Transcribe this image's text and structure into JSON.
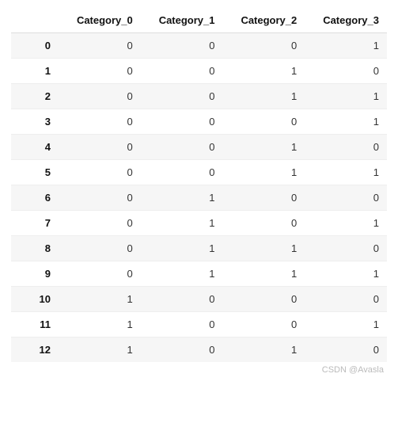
{
  "watermark": "CSDN @Avasla",
  "chart_data": {
    "type": "table",
    "title": "",
    "columns": [
      "Category_0",
      "Category_1",
      "Category_2",
      "Category_3"
    ],
    "index": [
      "0",
      "1",
      "2",
      "3",
      "4",
      "5",
      "6",
      "7",
      "8",
      "9",
      "10",
      "11",
      "12"
    ],
    "rows": [
      [
        0,
        0,
        0,
        1
      ],
      [
        0,
        0,
        1,
        0
      ],
      [
        0,
        0,
        1,
        1
      ],
      [
        0,
        0,
        0,
        1
      ],
      [
        0,
        0,
        1,
        0
      ],
      [
        0,
        0,
        1,
        1
      ],
      [
        0,
        1,
        0,
        0
      ],
      [
        0,
        1,
        0,
        1
      ],
      [
        0,
        1,
        1,
        0
      ],
      [
        0,
        1,
        1,
        1
      ],
      [
        1,
        0,
        0,
        0
      ],
      [
        1,
        0,
        0,
        1
      ],
      [
        1,
        0,
        1,
        0
      ]
    ]
  }
}
